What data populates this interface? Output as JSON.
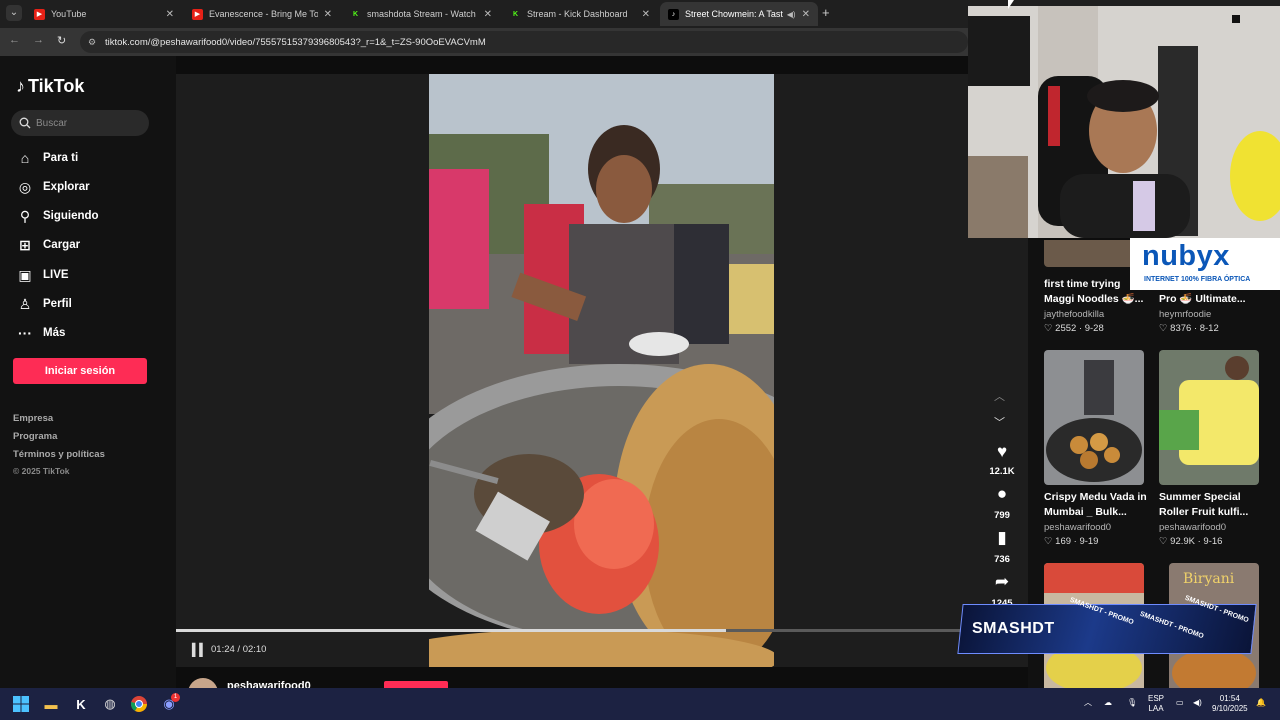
{
  "browser": {
    "tabs": [
      {
        "title": "YouTube",
        "icon": "youtube"
      },
      {
        "title": "Evanescence - Bring Me To Life",
        "icon": "youtube"
      },
      {
        "title": "smashdota Stream - Watch Live",
        "icon": "kick"
      },
      {
        "title": "Stream - Kick Dashboard",
        "icon": "kick"
      },
      {
        "title": "Street Chowmein: A Taste o",
        "icon": "tiktok"
      }
    ],
    "url": "tiktok.com/@peshawarifood0/video/7555751537939680543?_r=1&_t=ZS-90OoEVACVmM"
  },
  "sidebar": {
    "logo": "TikTok",
    "search_placeholder": "Buscar",
    "items": [
      {
        "label": "Para ti",
        "icon": "home-icon"
      },
      {
        "label": "Explorar",
        "icon": "compass-icon"
      },
      {
        "label": "Siguiendo",
        "icon": "user-icon"
      },
      {
        "label": "Cargar",
        "icon": "plus-icon"
      },
      {
        "label": "LIVE",
        "icon": "live-icon"
      },
      {
        "label": "Perfil",
        "icon": "profile-icon"
      },
      {
        "label": "Más",
        "icon": "more-icon"
      }
    ],
    "login_button": "Iniciar sesión",
    "footer_links": [
      "Empresa",
      "Programa",
      "Términos y políticas"
    ],
    "copyright": "© 2025 TikTok"
  },
  "player": {
    "time": "01:24 / 02:10",
    "progress": 0.646,
    "author_handle": "peshawarifood0"
  },
  "actions": {
    "likes": "12.1K",
    "comments": "799",
    "saves": "736",
    "shares": "1245"
  },
  "related": [
    {
      "title": "first time trying Maggi Noodles 🍜...",
      "author": "jaythefoodkilla",
      "stats": "♡ 2552 · 9-28"
    },
    {
      "title": "Pro 🍜 Ultimate...",
      "author": "heymrfoodie",
      "stats": "♡ 8376 · 8-12"
    },
    {
      "title": "Crispy Medu Vada in Mumbai _ Bulk...",
      "author": "peshawarifood0",
      "stats": "♡ 169 · 9-19"
    },
    {
      "title": "Summer Special Roller Fruit kulfi...",
      "author": "peshawarifood0",
      "stats": "♡ 92.9K · 9-16"
    },
    {
      "thumb_text": "Biryani"
    }
  ],
  "overlay": {
    "sponsor_brand": "nubyx",
    "sponsor_tagline": "INTERNET 100% FIBRA ÓPTICA",
    "promo_big": "SMASHDT",
    "promo_small": "SMASHDT - PROMO"
  },
  "taskbar": {
    "lang_top": "ESP",
    "lang_bottom": "LAA",
    "time": "01:54",
    "date": "9/10/2025",
    "notification_count": "1"
  },
  "colors": {
    "accent": "#fe2c55",
    "taskbar": "#1c2242",
    "sponsor": "#0b57b8"
  }
}
